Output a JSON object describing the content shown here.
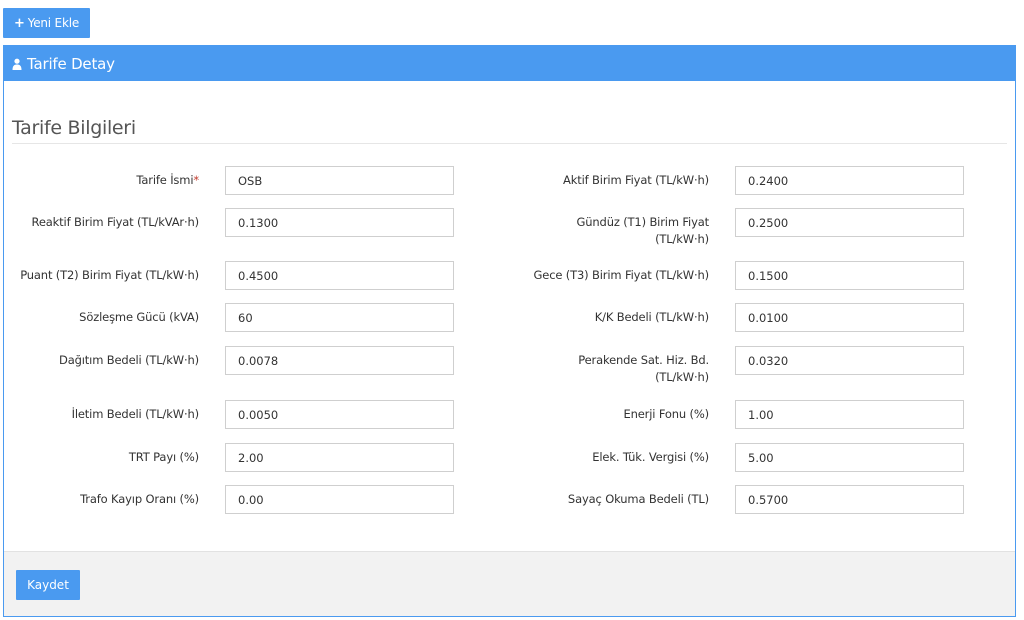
{
  "toolbar": {
    "new_label": "Yeni Ekle",
    "new_icon": "plus-icon"
  },
  "panel": {
    "title": "Tarife Detay",
    "title_icon": "user-icon",
    "accent": "#4a9af0"
  },
  "section": {
    "title": "Tarife Bilgileri"
  },
  "fields": {
    "tarife_ismi": {
      "label": "Tarife İsmi",
      "required_mark": "*",
      "value": "OSB"
    },
    "aktif_birim": {
      "label": "Aktif Birim Fiyat (TL/kW·h)",
      "value": "0.2400"
    },
    "reaktif_birim": {
      "label": "Reaktif Birim Fiyat (TL/kVAr·h)",
      "value": "0.1300"
    },
    "gunduz_t1": {
      "label_line1": "Gündüz (T1) Birim Fiyat",
      "label_line2": "(TL/kW·h)",
      "value": "0.2500"
    },
    "puant_t2": {
      "label": "Puant (T2) Birim Fiyat (TL/kW·h)",
      "value": "0.4500"
    },
    "gece_t3": {
      "label": "Gece (T3) Birim Fiyat (TL/kW·h)",
      "value": "0.1500"
    },
    "sozlesme_gucu": {
      "label": "Sözleşme Gücü (kVA)",
      "value": "60"
    },
    "kk_bedeli": {
      "label": "K/K Bedeli (TL/kW·h)",
      "value": "0.0100"
    },
    "dagitim_bedeli": {
      "label": "Dağıtım Bedeli (TL/kW·h)",
      "value": "0.0078"
    },
    "perakende": {
      "label_line1": "Perakende Sat. Hiz. Bd.",
      "label_line2": "(TL/kW·h)",
      "value": "0.0320"
    },
    "iletim_bedeli": {
      "label": "İletim Bedeli (TL/kW·h)",
      "value": "0.0050"
    },
    "enerji_fonu": {
      "label": "Enerji Fonu (%)",
      "value": "1.00"
    },
    "trt_payi": {
      "label": "TRT Payı (%)",
      "value": "2.00"
    },
    "elek_tuk": {
      "label": "Elek. Tük. Vergisi (%)",
      "value": "5.00"
    },
    "trafo_kayip": {
      "label": "Trafo Kayıp Oranı (%)",
      "value": "0.00"
    },
    "sayac_okuma": {
      "label": "Sayaç Okuma Bedeli (TL)",
      "value": "0.5700"
    }
  },
  "footer": {
    "save_label": "Kaydet"
  }
}
